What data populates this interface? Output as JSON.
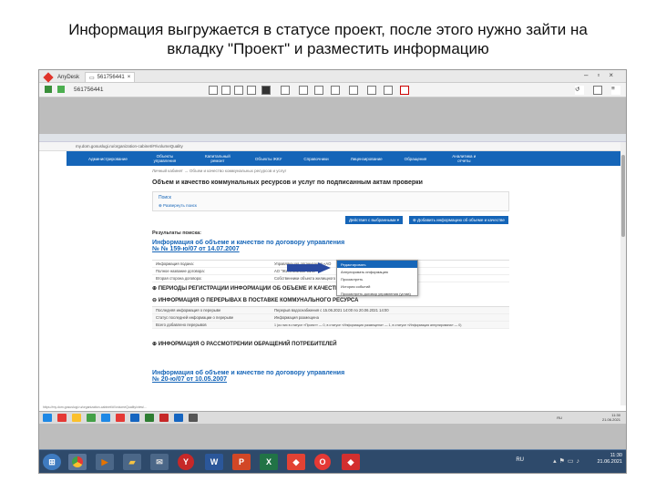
{
  "caption": {
    "line1": "Информация выгружается в статусе проект, после этого нужно зайти на",
    "line2": "вкладку \"Проект\" и разместить информацию"
  },
  "anydesk": {
    "app_name": "AnyDesk",
    "tab_id": "561756441",
    "address_id": "561756441"
  },
  "browser": {
    "url": "my.dom.gosuslugi.ru/organization-cabinet/#!/volumeQuality",
    "nav": [
      "Администрирование",
      "Объекты управления",
      "Капитальный ремонт",
      "Объекты ЖКУ",
      "Справочники",
      "Лицензирование",
      "Обращения",
      "Аналитика и отчеты"
    ]
  },
  "page": {
    "breadcrumb": "Личный кабинет → Объем и качество коммунальных ресурсов и услуг",
    "title": "Объем и качество коммунальных ресурсов и услуг по подписанным актам проверки",
    "search_label": "Поиск",
    "search_link": "Развернуть поиск",
    "actions_button": "Действия с выбранными ▾",
    "add_button": "Добавить информацию об объеме и качестве",
    "results_label": "Результаты поиска:",
    "contract1_link": "Информация об объеме и качестве по договору управления",
    "contract1_number": "№ № 159-ю/07 от 14.07.2007",
    "contract2_link": "Информация об объеме и качестве по договору управления",
    "contract2_number": "№ 20-ю/07 от 10.05.2007",
    "table1": [
      {
        "k": "Информация подана:",
        "v": "Управляющая организация «АО"
      },
      {
        "k": "Полное название договора:",
        "v": "АО \"ЖИЛКОМСЕРВИС\""
      },
      {
        "k": "Вторая сторона договора:",
        "v": "Собственники объекта жилищного"
      }
    ],
    "section1": "ПЕРИОДЫ РЕГИСТРАЦИИ ИНФОРМАЦИИ ОБ ОБЪЕМЕ И КАЧЕСТВЕ",
    "section2": "ИНФОРМАЦИЯ О ПЕРЕРЫВАХ В ПОСТАВКЕ КОММУНАЛЬНОГО РЕСУРСА",
    "table2": [
      {
        "k": "Последняя информация о перерыве",
        "v": "Перерыв водоснабжения с 15.06.2021 14:00 по 20.06.2021 14:00"
      },
      {
        "k": "Статус последней информации о перерыве",
        "v": "Информация размещена"
      },
      {
        "k": "Всего добавлено перерывов",
        "v": "1 (из них в статусе «Проект» — 0, в статусе «Информация размещена» — 1, в статусе «Информация аннулирована» — 0)"
      }
    ],
    "section3": "ИНФОРМАЦИЯ О РАССМОТРЕНИИ ОБРАЩЕНИЙ ПОТРЕБИТЕЛЕЙ",
    "menu": [
      "Редактировать",
      "Аннулировать информацию",
      "Просмотреть",
      "История событий",
      "Просмотреть договор управления (устав)"
    ],
    "status_url": "https://my.dom.gosuslugi.ru/organization-cabinet/#!/volumeQuality/view/..."
  },
  "inner_taskbar": {
    "lang": "RU",
    "time": "11:30",
    "date": "21.06.2021"
  },
  "taskbar": {
    "lang": "RU",
    "time": "11:30",
    "date": "21.06.2021",
    "icons": [
      "start",
      "chrome",
      "media",
      "explorer",
      "mail",
      "yandex",
      "word",
      "powerpoint",
      "excel",
      "anydesk-ps",
      "opera",
      "anydesk"
    ]
  }
}
